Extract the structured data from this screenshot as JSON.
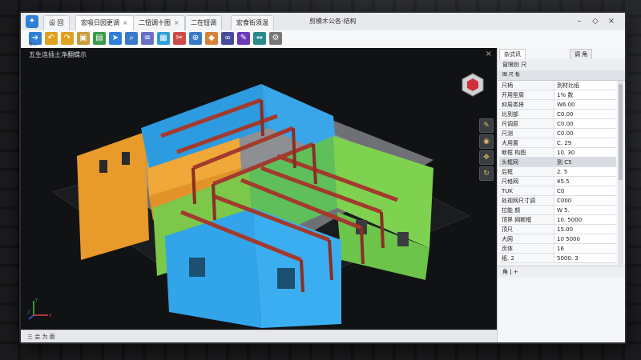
{
  "window": {
    "title": "剪模木公各·结构",
    "tabs": [
      {
        "label": "设 回",
        "active": false
      },
      {
        "label": "宏吸日园更调",
        "active": true
      },
      {
        "label": "二钮调十图",
        "active": false
      },
      {
        "label": "二在钮调",
        "active": false
      },
      {
        "label": "宏食街须温 ",
        "active": false
      }
    ]
  },
  "toolbar": {
    "tools": [
      {
        "icon": "arrow-icon",
        "label": "导入",
        "color": "#2f7fd8"
      },
      {
        "icon": "undo-icon",
        "label": "",
        "color": "#e0a020"
      },
      {
        "icon": "redo-icon",
        "label": "",
        "color": "#e0a020"
      },
      {
        "icon": "folder-icon",
        "label": "",
        "color": "#c79a3a"
      },
      {
        "icon": "save-icon",
        "label": "",
        "color": "#3a9a4a"
      },
      {
        "icon": "cursor-icon",
        "label": "",
        "color": "#2f7fd8"
      },
      {
        "icon": "search-icon",
        "label": "",
        "color": "#3a7ac8"
      },
      {
        "icon": "layers-icon",
        "label": "",
        "color": "#6a6fc8"
      },
      {
        "icon": "grid-icon",
        "label": "",
        "color": "#2f9fd8"
      },
      {
        "icon": "cut-icon",
        "label": "",
        "color": "#d04a4a"
      },
      {
        "icon": "zoom-icon",
        "label": "",
        "color": "#3a7ac8"
      },
      {
        "icon": "tag-icon",
        "label": "",
        "color": "#d7823a"
      },
      {
        "icon": "link-icon",
        "label": "",
        "color": "#4a4a9a"
      },
      {
        "icon": "pen-icon",
        "label": "",
        "color": "#6a3ab8"
      },
      {
        "icon": "measure-icon",
        "label": "",
        "color": "#2a8a8a"
      },
      {
        "icon": "settings-icon",
        "label": "",
        "color": "#777777"
      }
    ]
  },
  "viewport": {
    "title": "五生连插土净翻蝶示",
    "axis": {
      "x": "X",
      "y": "Y",
      "z": "Z"
    }
  },
  "status": {
    "text": "三 会 为 面"
  },
  "panel": {
    "tabs": [
      {
        "label": "杂式讯",
        "active": true
      },
      {
        "label": "调 角",
        "active": false
      }
    ],
    "subheader": "窗限别  尺",
    "subheader2": "图   尺  板",
    "rows": [
      {
        "key": "尺柄",
        "value": "到材比纸"
      },
      {
        "key": "开用型周",
        "value": "1% 数"
      },
      {
        "key": "抑周类将",
        "value": "W6.00"
      },
      {
        "key": "比到部",
        "value": "C0.00"
      },
      {
        "key": "尺调原",
        "value": "C0.00"
      },
      {
        "key": "尺测 ",
        "value": "C0.00"
      },
      {
        "key": "大用置",
        "value": "C. 29"
      },
      {
        "key": "断框 构图",
        "value": "10. 30"
      },
      {
        "key": "头框网",
        "value": "到 C5",
        "selected": true
      },
      {
        "key": "后框",
        "value": "2. 5"
      },
      {
        "key": "尺格网",
        "value": "¥5.5"
      },
      {
        "key": "TUK",
        "value": "C0"
      },
      {
        "key": "处视网尺寸调",
        "value": "C000"
      },
      {
        "key": "拉能 颜",
        "value": "W 5."
      },
      {
        "key": "顶界    网断框",
        "value": "10. 5000"
      },
      {
        "key": "顶尺",
        "value": "15.00"
      },
      {
        "key": "大网",
        "value": "10 5000"
      },
      {
        "key": "页体",
        "value": "16"
      },
      {
        "key": "纸. 2",
        "value": "5000. 3"
      }
    ],
    "footer": "角    |  +"
  }
}
